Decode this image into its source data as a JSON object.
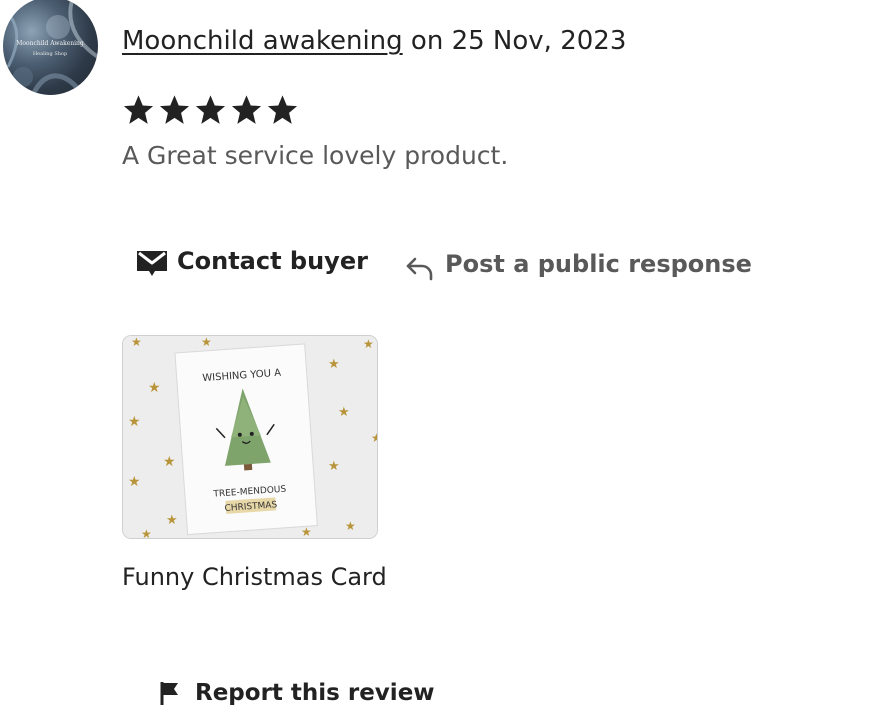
{
  "review": {
    "reviewer_name": "Moonchild awakening",
    "date_text": "on 25 Nov, 2023",
    "rating": 5,
    "rating_max": 5,
    "text": "A Great service lovely product.",
    "avatar_text_line1": "Moonchild Awakening",
    "avatar_text_line2": "Healing Shop"
  },
  "actions": {
    "contact_label": "Contact buyer",
    "contact_icon": "envelope-icon",
    "respond_label": "Post a public response",
    "respond_icon": "reply-arrow-icon"
  },
  "product": {
    "title": "Funny Christmas Card",
    "card_line1": "WISHING YOU A",
    "card_line2": "TREE-MENDOUS",
    "card_line3": "CHRISTMAS"
  },
  "report": {
    "label": "Report this review",
    "icon": "flag-icon"
  },
  "colors": {
    "text_primary": "#222222",
    "text_secondary": "#595959",
    "star": "#222222"
  }
}
